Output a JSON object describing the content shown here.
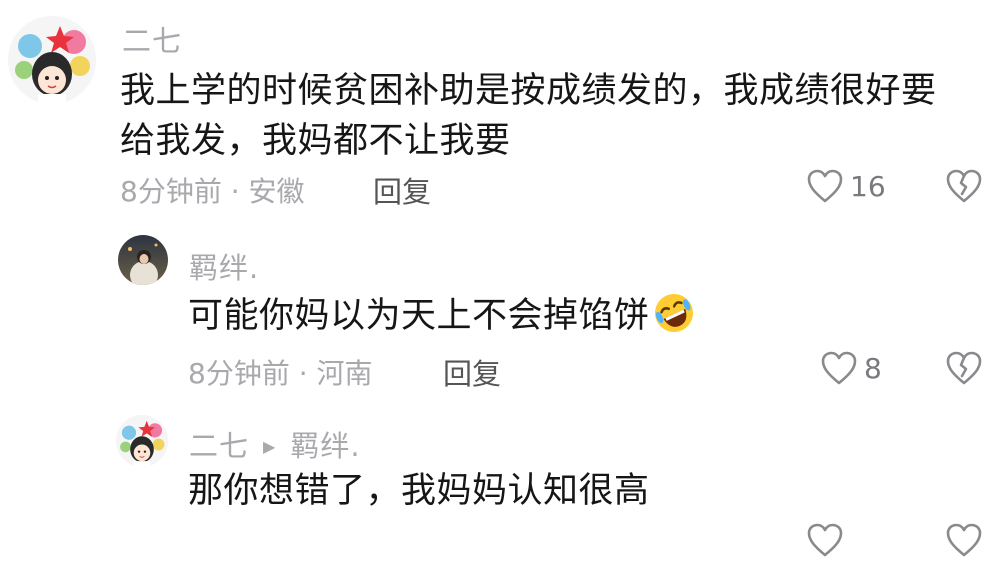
{
  "comments": [
    {
      "username": "二七",
      "text_line1": "我上学的时候贫困补助是按成绩发的，我成绩很好要",
      "text_line2": "给我发，我妈都不让我要",
      "meta": "8分钟前 · 安徽",
      "reply_label": "回复",
      "like_count": "16"
    },
    {
      "username": "羁绊.",
      "text": "可能你妈以为天上不会掉馅饼",
      "emoji": "rolling-on-floor-laughing",
      "meta": "8分钟前 · 河南",
      "reply_label": "回复",
      "like_count": "8"
    },
    {
      "username": "二七",
      "reply_to": "羁绊.",
      "text": "那你想错了，我妈妈认知很高"
    }
  ],
  "colors": {
    "text": "#161616",
    "muted": "#a9a9ad",
    "reply": "#555557"
  }
}
